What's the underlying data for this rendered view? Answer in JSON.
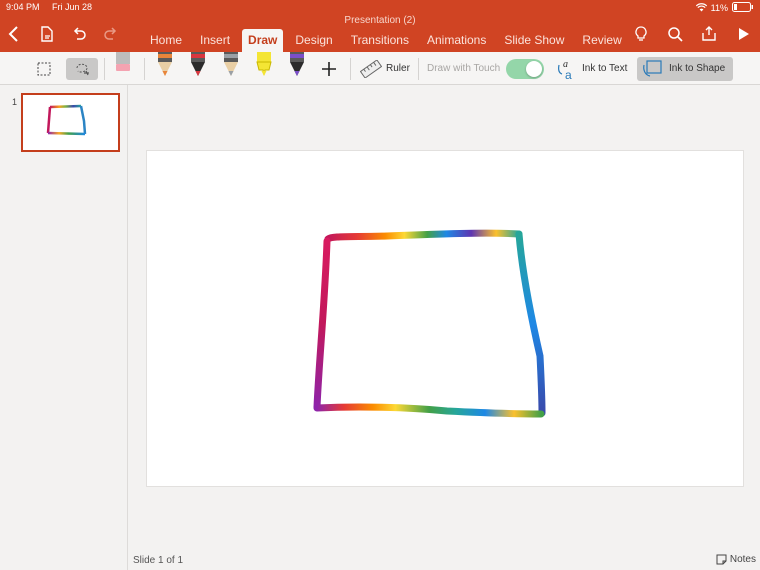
{
  "status_bar": {
    "time": "9:04 PM",
    "date": "Fri Jun 28",
    "battery": "11%"
  },
  "document": {
    "title": "Presentation (2)"
  },
  "tabs": [
    {
      "label": "Home"
    },
    {
      "label": "Insert"
    },
    {
      "label": "Draw",
      "active": true
    },
    {
      "label": "Design"
    },
    {
      "label": "Transitions"
    },
    {
      "label": "Animations"
    },
    {
      "label": "Slide Show"
    },
    {
      "label": "Review"
    }
  ],
  "ribbon": {
    "ruler_label": "Ruler",
    "draw_with_touch_label": "Draw with Touch",
    "draw_with_touch_on": true,
    "ink_to_text_label": "Ink to Text",
    "ink_to_shape_label": "Ink to Shape",
    "pens": [
      {
        "name": "pencil-orange",
        "color": "#e8853a"
      },
      {
        "name": "pen-red",
        "color": "#d9363e"
      },
      {
        "name": "pencil-gray",
        "color": "#9aa0a6"
      },
      {
        "name": "highlighter-yellow",
        "color": "#f4e534"
      },
      {
        "name": "pen-rainbow",
        "color": "#7b4fc9"
      }
    ]
  },
  "thumbnails": [
    {
      "number": "1"
    }
  ],
  "footer": {
    "slide_count": "Slide 1 of 1",
    "notes_label": "Notes"
  },
  "colors": {
    "accent": "#d04423",
    "selected_tab_text": "#c43e1c"
  }
}
